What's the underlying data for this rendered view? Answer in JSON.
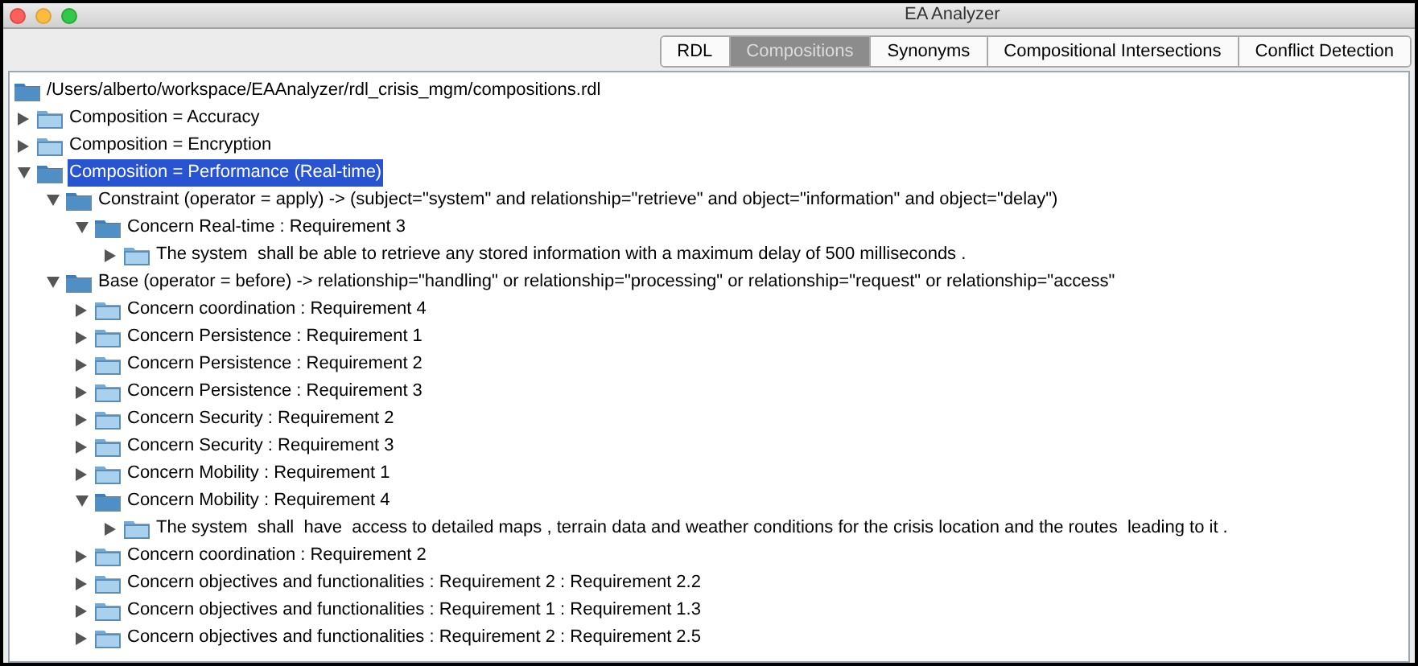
{
  "window": {
    "title": "EA Analyzer"
  },
  "tabs": [
    {
      "label": "RDL",
      "selected": false
    },
    {
      "label": "Compositions",
      "selected": true
    },
    {
      "label": "Synonyms",
      "selected": false
    },
    {
      "label": "Compositional Intersections",
      "selected": false
    },
    {
      "label": "Conflict Detection",
      "selected": false
    }
  ],
  "tree": {
    "root": "/Users/alberto/workspace/EAAnalyzer/rdl_crisis_mgm/compositions.rdl",
    "children": [
      {
        "label": "Composition = Accuracy",
        "expanded": false,
        "selected": false
      },
      {
        "label": "Composition = Encryption",
        "expanded": false,
        "selected": false
      },
      {
        "label": "Composition = Performance (Real-time)",
        "expanded": true,
        "selected": true,
        "children": [
          {
            "label": "Constraint (operator = apply) -> (subject=\"system\" and relationship=\"retrieve\" and object=\"information\" and object=\"delay\")",
            "expanded": true,
            "selected": false,
            "children": [
              {
                "label": "Concern Real-time : Requirement 3",
                "expanded": true,
                "selected": false,
                "children": [
                  {
                    "label": "The system  shall be able to retrieve any stored information with a maximum delay of 500 milliseconds .",
                    "expanded": false,
                    "selected": false
                  }
                ]
              }
            ]
          },
          {
            "label": "Base (operator = before) -> relationship=\"handling\" or relationship=\"processing\" or relationship=\"request\" or relationship=\"access\"",
            "expanded": true,
            "selected": false,
            "children": [
              {
                "label": "Concern coordination : Requirement 4",
                "expanded": false,
                "selected": false
              },
              {
                "label": "Concern Persistence : Requirement 1",
                "expanded": false,
                "selected": false
              },
              {
                "label": "Concern Persistence : Requirement 2",
                "expanded": false,
                "selected": false
              },
              {
                "label": "Concern Persistence : Requirement 3",
                "expanded": false,
                "selected": false
              },
              {
                "label": "Concern Security : Requirement 2",
                "expanded": false,
                "selected": false
              },
              {
                "label": "Concern Security : Requirement 3",
                "expanded": false,
                "selected": false
              },
              {
                "label": "Concern Mobility : Requirement 1",
                "expanded": false,
                "selected": false
              },
              {
                "label": "Concern Mobility : Requirement 4",
                "expanded": true,
                "selected": false,
                "children": [
                  {
                    "label": "The system  shall  have  access to detailed maps , terrain data and weather conditions for the crisis location and the routes  leading to it .",
                    "expanded": false,
                    "selected": false
                  }
                ]
              },
              {
                "label": "Concern coordination : Requirement 2",
                "expanded": false,
                "selected": false
              },
              {
                "label": "Concern objectives and functionalities : Requirement 2 : Requirement 2.2",
                "expanded": false,
                "selected": false
              },
              {
                "label": "Concern objectives and functionalities : Requirement 1 : Requirement 1.3",
                "expanded": false,
                "selected": false
              },
              {
                "label": "Concern objectives and functionalities : Requirement 2 : Requirement 2.5",
                "expanded": false,
                "selected": false
              }
            ]
          }
        ]
      }
    ]
  }
}
